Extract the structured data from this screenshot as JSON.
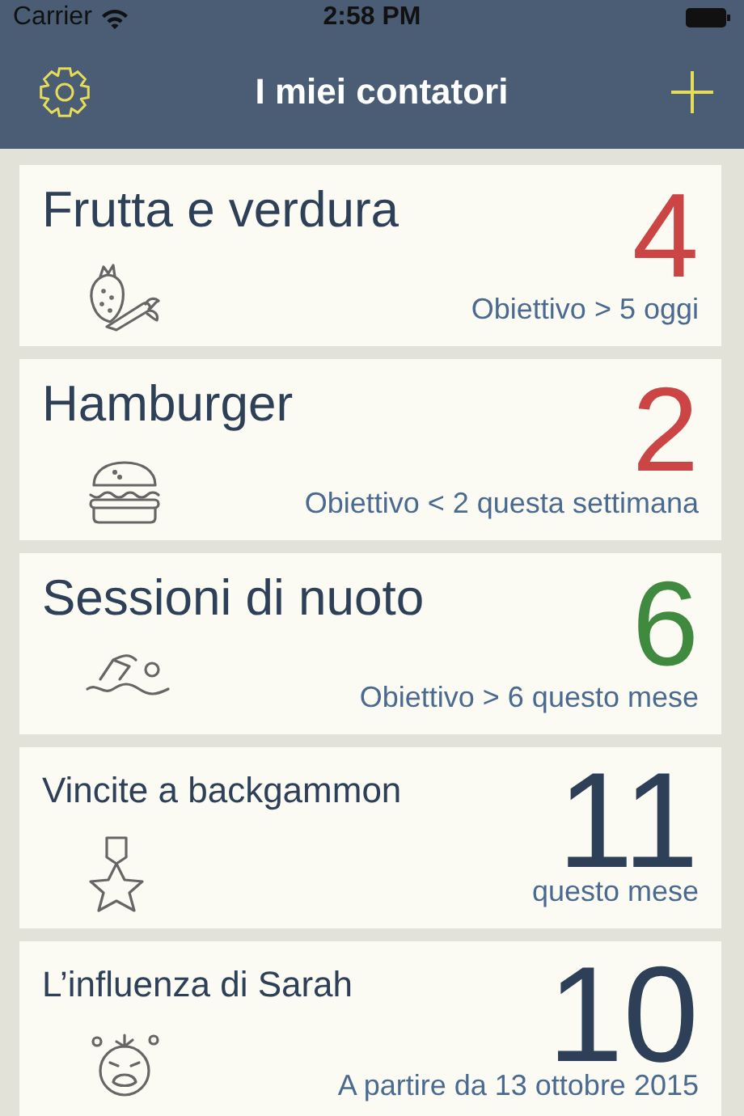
{
  "status_bar": {
    "carrier": "Carrier",
    "time": "2:58 PM"
  },
  "nav_bar": {
    "title": "I miei contatori"
  },
  "counters": [
    {
      "title": "Frutta e verdura",
      "count": "4",
      "color": "#cc4545",
      "goal": "Obiettivo > 5 oggi"
    },
    {
      "title": "Hamburger",
      "count": "2",
      "color": "#cc4545",
      "goal": "Obiettivo < 2 questa settimana"
    },
    {
      "title": "Sessioni di nuoto",
      "count": "6",
      "color": "#3f8a3f",
      "goal": "Obiettivo > 6 questo mese"
    },
    {
      "title": "Vincite a backgammon",
      "count": "11",
      "color": "#2d4058",
      "goal": "questo mese"
    },
    {
      "title": "L’influenza di Sarah",
      "count": "10",
      "color": "#2d4058",
      "goal": "A partire da 13 ottobre 2015"
    }
  ]
}
